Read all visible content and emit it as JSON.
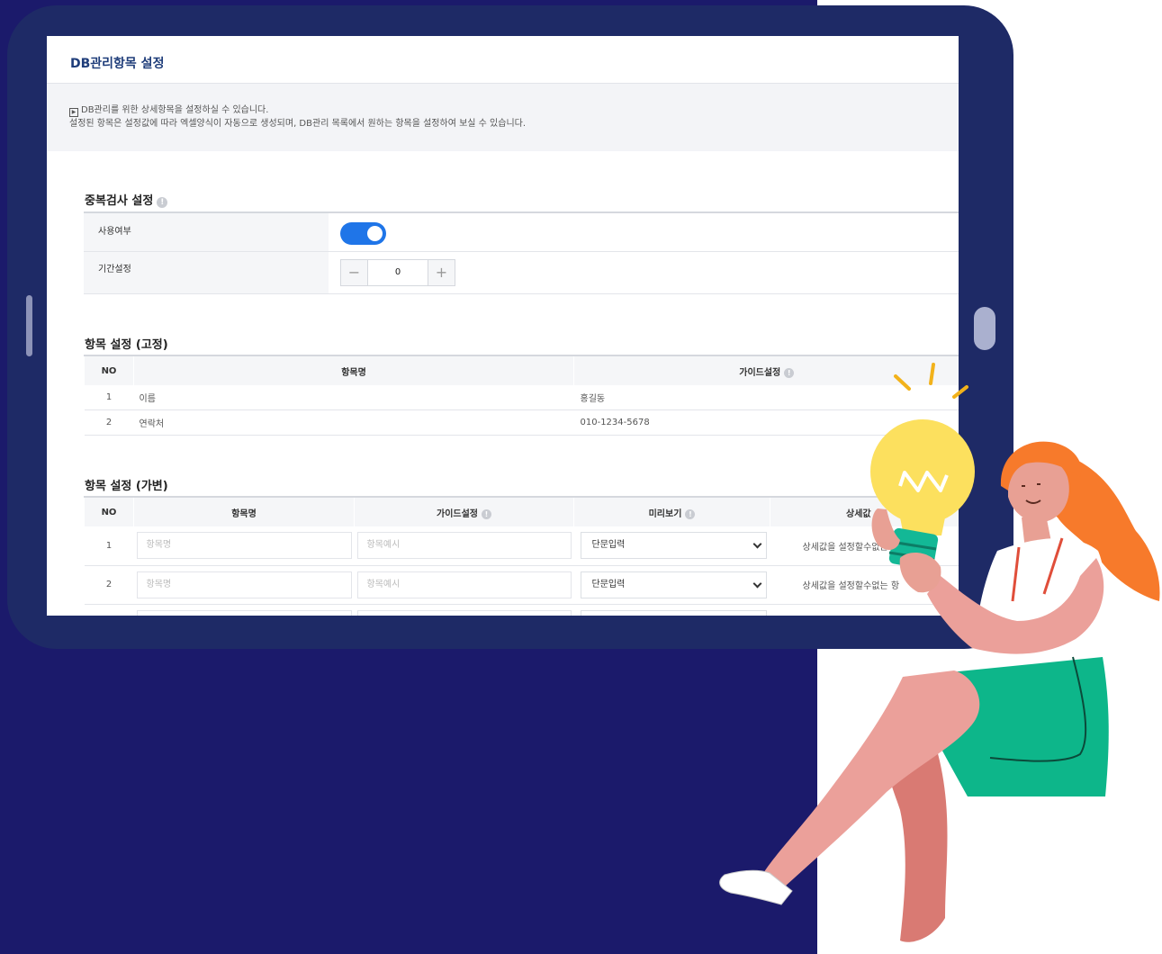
{
  "page": {
    "title": "DB관리항목 설정",
    "info_line1": "DB관리를 위한 상세항목을 설정하실 수 있습니다.",
    "info_line2": "설정된 항목은 설정값에 따라 엑셀양식이 자동으로 생성되며, DB관리 목록에서 원하는 항목을 설정하여 보실 수 있습니다."
  },
  "duplicate_check": {
    "title": "중복검사 설정",
    "use_label": "사용여부",
    "use_enabled": true,
    "period_label": "기간설정",
    "period_value": "0",
    "minus": "−",
    "plus": "+"
  },
  "fixed_items": {
    "title": "항목 설정 (고정)",
    "columns": {
      "no": "NO",
      "name": "항목명",
      "guide": "가이드설정"
    },
    "rows": [
      {
        "no": "1",
        "name": "이름",
        "guide": "홍길동"
      },
      {
        "no": "2",
        "name": "연락처",
        "guide": "010-1234-5678"
      }
    ]
  },
  "variable_items": {
    "title": "항목 설정 (가변)",
    "columns": {
      "no": "NO",
      "name": "항목명",
      "guide": "가이드설정",
      "preview": "미리보기",
      "detail": "상세값"
    },
    "rows": [
      {
        "no": "1",
        "name_placeholder": "항목명",
        "guide_placeholder": "항목예시",
        "preview": "단문입력",
        "detail": "상세값을 설정할수없는 항"
      },
      {
        "no": "2",
        "name_placeholder": "항목명",
        "guide_placeholder": "항목예시",
        "preview": "단문입력",
        "detail": "상세값을 설정할수없는 항"
      }
    ]
  },
  "colors": {
    "background_navy": "#1b1a6b",
    "tablet_frame": "#1e2a66",
    "toggle_on": "#1f75e8",
    "title_blue": "#1f3d7a"
  }
}
